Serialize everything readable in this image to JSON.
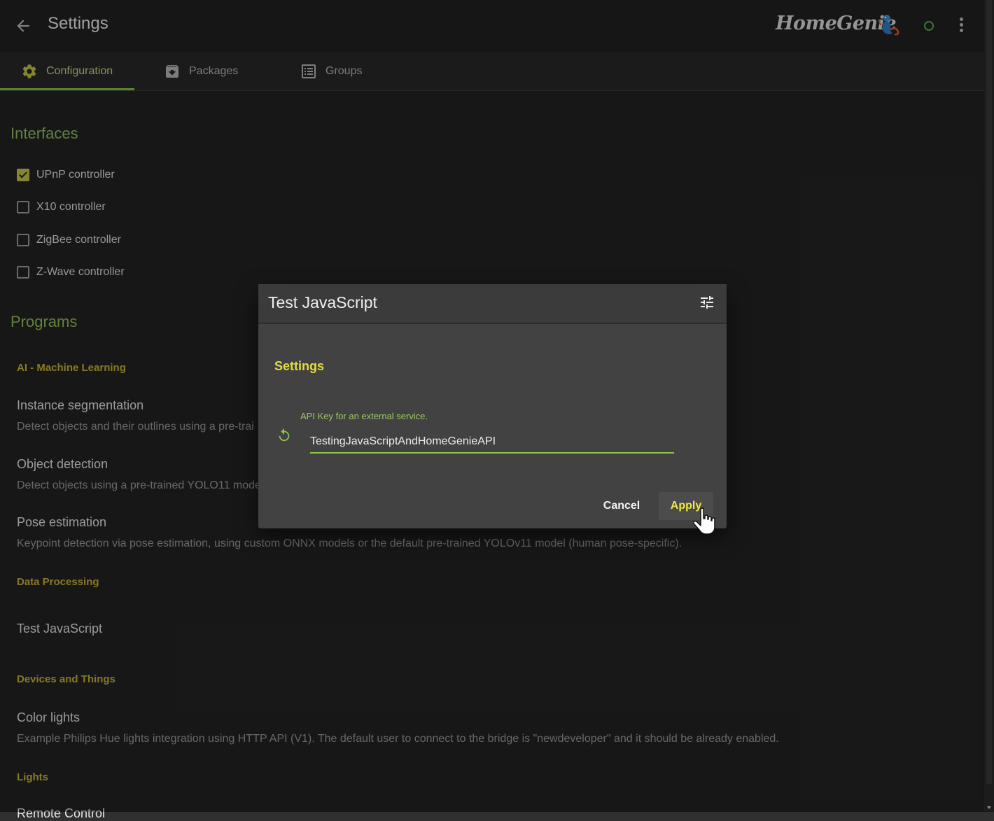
{
  "header": {
    "title": "Settings",
    "logo_text": "HomeGenie",
    "status_color": "#4caf50"
  },
  "tabs": [
    {
      "label": "Configuration",
      "icon": "gear-icon",
      "active": true
    },
    {
      "label": "Packages",
      "icon": "package-icon",
      "active": false
    },
    {
      "label": "Groups",
      "icon": "list-icon",
      "active": false
    }
  ],
  "interfaces": {
    "title": "Interfaces",
    "items": [
      {
        "label": "UPnP controller",
        "checked": true
      },
      {
        "label": "X10 controller",
        "checked": false
      },
      {
        "label": "ZigBee controller",
        "checked": false
      },
      {
        "label": "Z-Wave controller",
        "checked": false
      }
    ]
  },
  "programs": {
    "title": "Programs",
    "categories": [
      {
        "name": "AI - Machine Learning"
      },
      {
        "name": "Data Processing"
      },
      {
        "name": "Devices and Things"
      },
      {
        "name": "Lights"
      }
    ],
    "items": [
      {
        "name": "Instance segmentation",
        "description": "Detect objects and their outlines using a pre-trai"
      },
      {
        "name": "Object detection",
        "description": "Detect objects using a pre-trained YOLO11 mode"
      },
      {
        "name": "Pose estimation",
        "description": "Keypoint detection via pose estimation, using custom ONNX models or the default pre-trained YOLOv11 model (human pose-specific)."
      },
      {
        "name": "Test JavaScript",
        "description": ""
      },
      {
        "name": "Color lights",
        "description": "Example Philips Hue lights integration using HTTP API (V1). The default user to connect to the bridge is \"newdeveloper\" and it should be already enabled."
      },
      {
        "name": "Remote Control",
        "description": ""
      }
    ]
  },
  "dialog": {
    "title": "Test JavaScript",
    "section": "Settings",
    "field_label": "API Key for an external service.",
    "field_value": "TestingJavaScriptAndHomeGenieAPI",
    "cancel_label": "Cancel",
    "apply_label": "Apply"
  },
  "colors": {
    "accent_green": "#8bc34a",
    "category_yellow": "#c9b33a",
    "apply_yellow": "#f1e83e"
  }
}
